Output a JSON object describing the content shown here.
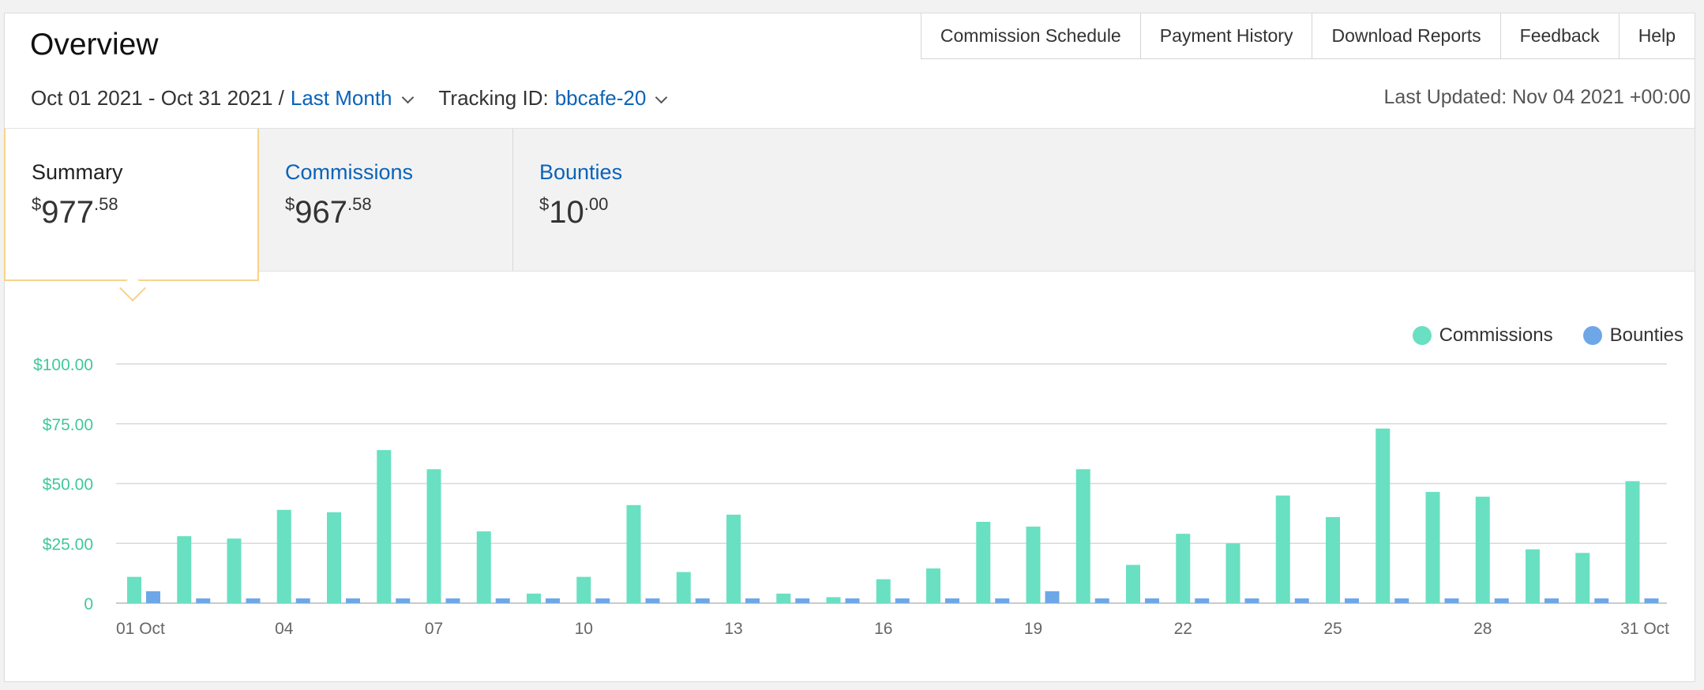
{
  "header": {
    "title": "Overview",
    "nav": [
      "Commission Schedule",
      "Payment History",
      "Download Reports",
      "Feedback",
      "Help"
    ]
  },
  "filters": {
    "date_range": "Oct 01 2021 - Oct 31 2021 /",
    "period": "Last Month",
    "tracking_label": "Tracking ID:",
    "tracking_id": "bbcafe-20",
    "last_updated": "Last Updated: Nov 04 2021 +00:00"
  },
  "tabs": {
    "summary": {
      "label": "Summary",
      "currency": "$",
      "whole": "977",
      "cents": ".58"
    },
    "commissions": {
      "label": "Commissions",
      "currency": "$",
      "whole": "967",
      "cents": ".58"
    },
    "bounties": {
      "label": "Bounties",
      "currency": "$",
      "whole": "10",
      "cents": ".00"
    }
  },
  "legend": {
    "commissions": "Commissions",
    "bounties": "Bounties"
  },
  "colors": {
    "commissions": "#69e0c1",
    "bounties": "#6ea7e8",
    "axis_label": "#40c89c",
    "link": "#0a63b8",
    "active_border": "#f7d28b"
  },
  "chart_data": {
    "type": "bar",
    "x": [
      1,
      2,
      3,
      4,
      5,
      6,
      7,
      8,
      9,
      10,
      11,
      12,
      13,
      14,
      15,
      16,
      17,
      18,
      19,
      20,
      21,
      22,
      23,
      24,
      25,
      26,
      27,
      28,
      29,
      30,
      31
    ],
    "x_tick_labels": [
      {
        "day": 1,
        "label": "01 Oct"
      },
      {
        "day": 4,
        "label": "04"
      },
      {
        "day": 7,
        "label": "07"
      },
      {
        "day": 10,
        "label": "10"
      },
      {
        "day": 13,
        "label": "13"
      },
      {
        "day": 16,
        "label": "16"
      },
      {
        "day": 19,
        "label": "19"
      },
      {
        "day": 22,
        "label": "22"
      },
      {
        "day": 25,
        "label": "25"
      },
      {
        "day": 28,
        "label": "28"
      },
      {
        "day": 31,
        "label": "31 Oct"
      }
    ],
    "y_ticks": [
      0,
      25,
      50,
      75,
      100
    ],
    "y_tick_labels": [
      "0",
      "$25.00",
      "$50.00",
      "$75.00",
      "$100.00"
    ],
    "ylim": [
      0,
      100
    ],
    "series": [
      {
        "name": "Commissions",
        "values": [
          11,
          28,
          27,
          39,
          38,
          64,
          56,
          30,
          4,
          11,
          41,
          13,
          37,
          4,
          2.5,
          10,
          14.5,
          34,
          32,
          56,
          16,
          29,
          25,
          45,
          36,
          73,
          46.5,
          44.5,
          22.5,
          21,
          51
        ]
      },
      {
        "name": "Bounties",
        "values": [
          5,
          2,
          2,
          2,
          2,
          2,
          2,
          2,
          2,
          2,
          2,
          2,
          2,
          2,
          2,
          2,
          2,
          2,
          5,
          2,
          2,
          2,
          2,
          2,
          2,
          2,
          2,
          2,
          2,
          2,
          2
        ]
      }
    ],
    "grid": true,
    "legend_position": "top-right"
  }
}
